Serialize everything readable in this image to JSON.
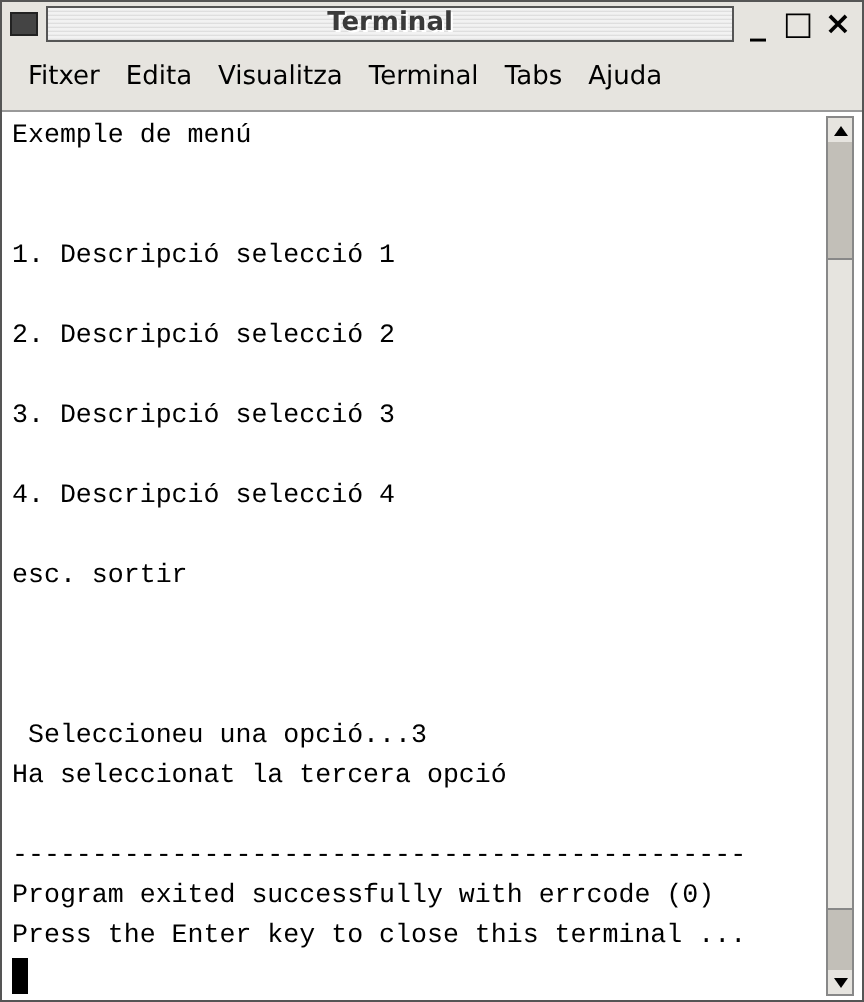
{
  "window": {
    "title": "Terminal",
    "controls": [
      "_",
      "□",
      "×"
    ]
  },
  "menu": [
    "Fitxer",
    "Edita",
    "Visualitza",
    "Terminal",
    "Tabs",
    "Ajuda"
  ],
  "terminal": {
    "lines": [
      {
        "kind": "text",
        "text": "Exemple de menú"
      },
      {
        "kind": "blank"
      },
      {
        "kind": "blank"
      },
      {
        "kind": "text",
        "text": "1. Descripció selecció 1"
      },
      {
        "kind": "blank"
      },
      {
        "kind": "text",
        "text": "2. Descripció selecció 2"
      },
      {
        "kind": "blank"
      },
      {
        "kind": "text",
        "text": "3. Descripció selecció 3"
      },
      {
        "kind": "blank"
      },
      {
        "kind": "text",
        "text": "4. Descripció selecció 4"
      },
      {
        "kind": "blank"
      },
      {
        "kind": "text",
        "text": "esc. sortir"
      },
      {
        "kind": "blank"
      },
      {
        "kind": "blank"
      },
      {
        "kind": "blank"
      },
      {
        "kind": "text",
        "text": " Seleccioneu una opció...3"
      },
      {
        "kind": "text",
        "text": "Ha seleccionat la tercera opció"
      },
      {
        "kind": "blank"
      },
      {
        "kind": "text",
        "text": "----------------------------------------------"
      },
      {
        "kind": "text",
        "text": "Program exited successfully with errcode (0)"
      },
      {
        "kind": "text",
        "text": "Press the Enter key to close this terminal ..."
      },
      {
        "kind": "cursor"
      }
    ]
  }
}
